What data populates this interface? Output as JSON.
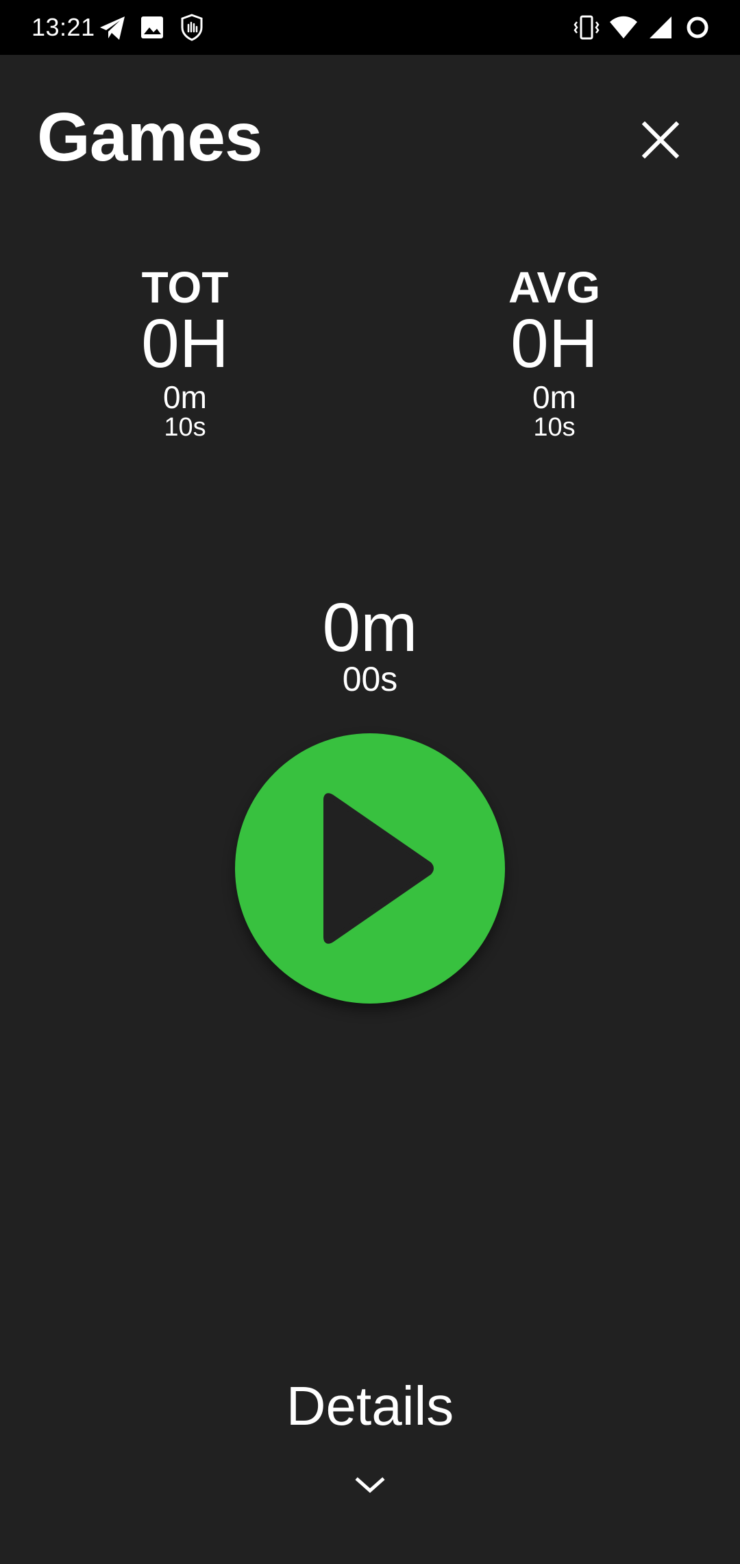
{
  "status_bar": {
    "time": "13:21",
    "left_icons": [
      "telegram-icon",
      "image-icon",
      "shield-hand-icon"
    ],
    "right_icons": [
      "vibrate-icon",
      "wifi-icon",
      "signal-icon",
      "battery-ring-icon"
    ]
  },
  "header": {
    "title": "Games",
    "close_icon": "close-icon"
  },
  "stats": {
    "total": {
      "label": "TOT",
      "hours": "0H",
      "minutes": "0m",
      "seconds": "10s"
    },
    "average": {
      "label": "AVG",
      "hours": "0H",
      "minutes": "0m",
      "seconds": "10s"
    }
  },
  "timer": {
    "minutes": "0m",
    "seconds": "00s"
  },
  "play_button": {
    "icon": "play-icon",
    "color": "#38c13f"
  },
  "details": {
    "label": "Details",
    "icon": "chevron-down-icon"
  },
  "colors": {
    "background": "#212121",
    "status_bar": "#000000",
    "accent": "#38c13f"
  }
}
